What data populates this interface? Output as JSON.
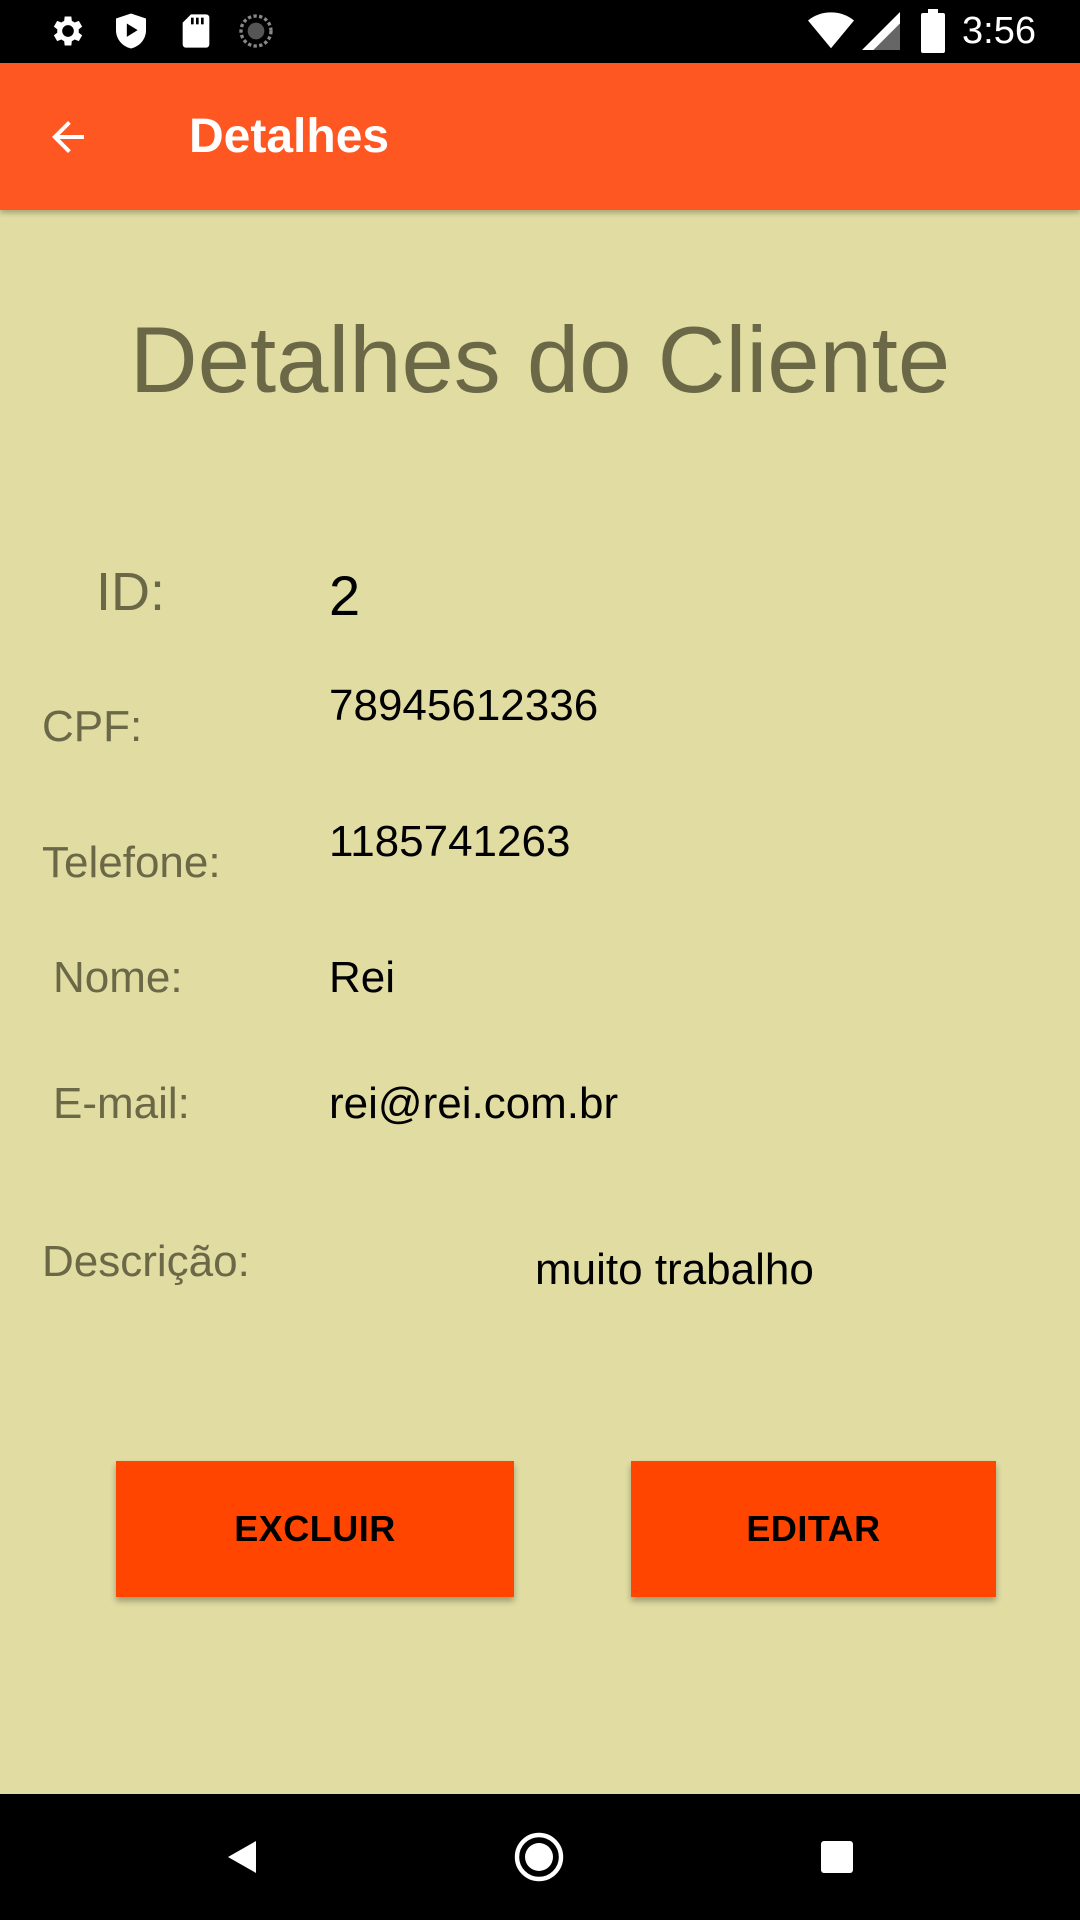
{
  "status_bar": {
    "time": "3:56",
    "left_icons": [
      "gear-icon",
      "shield-play-icon",
      "sd-card-icon",
      "sync-circle-icon"
    ],
    "right_icons": [
      "wifi-icon",
      "cell-signal-icon",
      "battery-icon"
    ]
  },
  "app_bar": {
    "title": "Detalhes",
    "back_icon": "arrow-left-icon",
    "color": "#FF5722"
  },
  "page": {
    "heading": "Detalhes do Cliente",
    "background": "#E0DCA2"
  },
  "fields": {
    "id": {
      "label": "ID:",
      "value": "2"
    },
    "cpf": {
      "label": "CPF:",
      "value": "78945612336"
    },
    "telefone": {
      "label": "Telefone:",
      "value": "1185741263"
    },
    "nome": {
      "label": "Nome:",
      "value": "Rei"
    },
    "email": {
      "label": "E-mail:",
      "value": "rei@rei.com.br"
    },
    "descricao": {
      "label": "Descrição:",
      "value": "muito trabalho"
    }
  },
  "buttons": {
    "delete_label": "EXCLUIR",
    "edit_label": "EDITAR",
    "color": "#FF4500"
  },
  "nav_bar": {
    "icons": [
      "back-triangle-icon",
      "home-circle-icon",
      "recents-square-icon"
    ]
  }
}
